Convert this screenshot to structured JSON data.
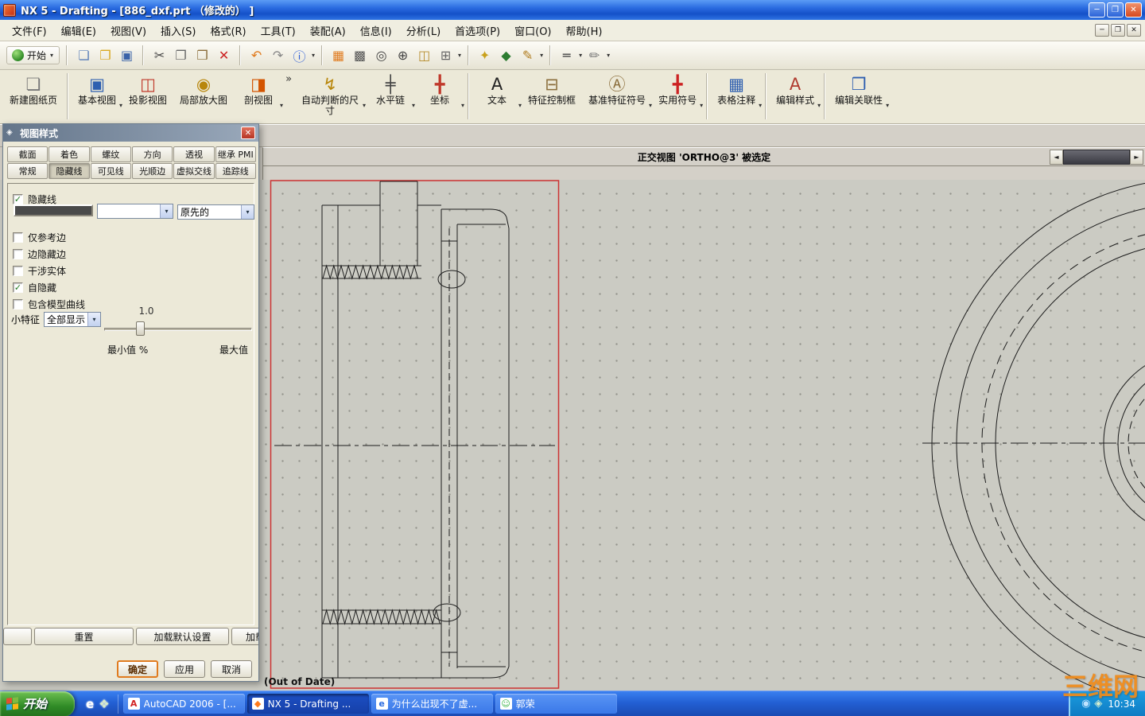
{
  "colors": {
    "selection_red": "#cc3333",
    "watermark_orange": "#f08a18",
    "accent_orange": "#e07b1f",
    "taskbar_blue_light": "#3a80f0",
    "start_green_light": "#6fc152",
    "tray_blue": "#1b9ce0",
    "hidden_line_gray": "#4a4a4a"
  },
  "icons": {
    "minimize": "─",
    "restore": "❐",
    "close": "✕",
    "dropdown": "▾",
    "check": "✓",
    "scroll_left": "◄",
    "scroll_right": "►",
    "overflow": "»",
    "grip": "◈"
  },
  "window": {
    "title": "NX 5 - Drafting - [886_dxf.prt （修改的） ]"
  },
  "menu": {
    "items": [
      "文件(F)",
      "编辑(E)",
      "视图(V)",
      "插入(S)",
      "格式(R)",
      "工具(T)",
      "装配(A)",
      "信息(I)",
      "分析(L)",
      "首选项(P)",
      "窗口(O)",
      "帮助(H)"
    ]
  },
  "toolbar1": {
    "start_label": "开始",
    "icons": [
      {
        "type": "icon",
        "name": "new-file-icon",
        "glyph": "❏",
        "color": "#5b7fb9"
      },
      {
        "type": "icon",
        "name": "open-folder-icon",
        "glyph": "❒",
        "color": "#d9a821"
      },
      {
        "type": "icon",
        "name": "save-icon",
        "glyph": "▣",
        "color": "#3a62a8"
      },
      {
        "type": "sep"
      },
      {
        "type": "icon",
        "name": "cut-icon",
        "glyph": "✂",
        "color": "#444444"
      },
      {
        "type": "icon",
        "name": "copy-icon",
        "glyph": "❐",
        "color": "#666666"
      },
      {
        "type": "icon",
        "name": "paste-icon",
        "glyph": "❒",
        "color": "#8a6d3b"
      },
      {
        "type": "icon",
        "name": "delete-icon",
        "glyph": "✕",
        "color": "#cc2222"
      },
      {
        "type": "sep"
      },
      {
        "type": "icon",
        "name": "undo-icon",
        "glyph": "↶",
        "color": "#e07b1f"
      },
      {
        "type": "icon",
        "name": "redo-icon",
        "glyph": "↷",
        "color": "#888888"
      },
      {
        "type": "icon",
        "name": "command-finder-icon",
        "glyph": "ⓘ",
        "color": "#2a5bd7",
        "dropdown": true
      },
      {
        "type": "sep"
      },
      {
        "type": "icon",
        "name": "ortho-grid-icon",
        "glyph": "▦",
        "color": "#e07b1f"
      },
      {
        "type": "icon",
        "name": "shaded-view-icon",
        "glyph": "▩",
        "color": "#555555"
      },
      {
        "type": "icon",
        "name": "zoom-window-icon",
        "glyph": "◎",
        "color": "#444444"
      },
      {
        "type": "icon",
        "name": "zoom-in-icon",
        "glyph": "⊕",
        "color": "#444444"
      },
      {
        "type": "icon",
        "name": "screenshot-icon",
        "glyph": "◫",
        "color": "#b58a2a"
      },
      {
        "type": "icon",
        "name": "view-operations-icon",
        "glyph": "⊞",
        "color": "#666666",
        "dropdown": true
      },
      {
        "type": "sep"
      },
      {
        "type": "icon",
        "name": "datum-icon",
        "glyph": "✦",
        "color": "#c9a11c"
      },
      {
        "type": "icon",
        "name": "point-icon",
        "glyph": "◆",
        "color": "#2e7d32"
      },
      {
        "type": "icon",
        "name": "sketch-tools-icon",
        "glyph": "✎",
        "color": "#b07c1f",
        "dropdown": true
      },
      {
        "type": "sep"
      },
      {
        "type": "icon",
        "name": "edge-display-icon",
        "glyph": "═",
        "color": "#444444",
        "dropdown": true
      },
      {
        "type": "icon",
        "name": "annotation-pen-icon",
        "glyph": "✏",
        "color": "#777777",
        "dropdown": true
      }
    ]
  },
  "toolbar2": {
    "buttons": [
      {
        "label": "新建图纸页",
        "icon": "new-sheet-icon",
        "glyph": "❏",
        "color": "#777777",
        "dropdown": false
      },
      {
        "type": "sep"
      },
      {
        "label": "基本视图",
        "icon": "base-view-icon",
        "glyph": "▣",
        "color": "#2e5fb0",
        "dropdown": true
      },
      {
        "label": "投影视图",
        "icon": "projected-view-icon",
        "glyph": "◫",
        "color": "#c0392b",
        "dropdown": false
      },
      {
        "label": "局部放大图",
        "icon": "detail-view-icon",
        "glyph": "◉",
        "color": "#b8860b",
        "dropdown": false
      },
      {
        "label": "剖视图",
        "icon": "section-view-icon",
        "glyph": "◨",
        "color": "#d35400",
        "dropdown": true
      },
      {
        "type": "chevron"
      },
      {
        "label": "自动判断的尺寸",
        "icon": "auto-dimension-icon",
        "glyph": "↯",
        "color": "#b8860b",
        "dropdown": true,
        "narrow": true
      },
      {
        "label": "水平链",
        "icon": "horizontal-chain-icon",
        "glyph": "╪",
        "color": "#444444",
        "dropdown": true
      },
      {
        "label": "坐标",
        "icon": "ordinate-icon",
        "glyph": "╋",
        "color": "#c0392b",
        "dropdown": true
      },
      {
        "type": "sep"
      },
      {
        "label": "文本",
        "icon": "text-icon",
        "glyph": "A",
        "color": "#222222",
        "dropdown": true
      },
      {
        "label": "特征控制框",
        "icon": "feature-control-frame-icon",
        "glyph": "⊟",
        "color": "#8a6d3b",
        "dropdown": false
      },
      {
        "label": "基准特征符号",
        "icon": "datum-feature-symbol-icon",
        "glyph": "Ⓐ",
        "color": "#8a6d3b",
        "dropdown": true
      },
      {
        "label": "实用符号",
        "icon": "utility-symbol-icon",
        "glyph": "╋",
        "color": "#cc2222",
        "dropdown": true
      },
      {
        "type": "sep"
      },
      {
        "label": "表格注释",
        "icon": "tabular-note-icon",
        "glyph": "▦",
        "color": "#2e5fb0",
        "dropdown": true
      },
      {
        "type": "sep"
      },
      {
        "label": "编辑样式",
        "icon": "edit-style-icon",
        "glyph": "A",
        "color": "#b03a2e",
        "dropdown": true
      },
      {
        "type": "sep"
      },
      {
        "label": "编辑关联性",
        "icon": "edit-associativity-icon",
        "glyph": "❒",
        "color": "#2e5fb0",
        "dropdown": true
      }
    ]
  },
  "prompt": {
    "text": "正交视图 'ORTHO@3' 被选定"
  },
  "dialog": {
    "title": "视图样式",
    "tabs_row1": [
      "截面",
      "着色",
      "螺纹",
      "方向",
      "透视",
      "继承 PMI"
    ],
    "tabs_row2": [
      "常规",
      "隐藏线",
      "可见线",
      "光顺边",
      "虚拟交线",
      "追踪线"
    ],
    "active_tab": "隐藏线",
    "hidden_line_checkbox": {
      "label": "隐藏线",
      "checked": true
    },
    "linetype_value": "dashed",
    "width_value": "原先的",
    "option_checkboxes": [
      {
        "label": "仅参考边",
        "checked": false
      },
      {
        "label": "边隐藏边",
        "checked": false
      },
      {
        "label": "干涉实体",
        "checked": false
      },
      {
        "label": "自隐藏",
        "checked": true
      },
      {
        "label": "包含模型曲线",
        "checked": false
      }
    ],
    "small_feature_label": "小特征",
    "small_feature_value": "全部显示",
    "slider_value": "1.0",
    "slider_min_label": "最小值 %",
    "slider_max_label": "最大值",
    "buttons": {
      "reset": "重置",
      "load_defaults": "加载默认设置",
      "load": "加载",
      "ok": "确定",
      "apply": "应用",
      "cancel": "取消"
    }
  },
  "canvas": {
    "out_of_date": "(Out of Date)"
  },
  "taskbar": {
    "start_label": "开始",
    "quick_launch": [
      {
        "name": "ie-quicklaunch-icon",
        "glyph": "e",
        "color": "#ffffff"
      },
      {
        "name": "show-desktop-icon",
        "glyph": "❖",
        "color": "#d8ecc8"
      }
    ],
    "tasks": [
      {
        "label": "AutoCAD 2006 - [...",
        "icon": "autocad-icon",
        "glyph": "A",
        "color": "#d22222",
        "active": false
      },
      {
        "label": "NX 5 - Drafting ...",
        "icon": "nx-icon",
        "glyph": "◆",
        "color": "#ff7a1a",
        "active": true
      },
      {
        "label": "为什么出现不了虚...",
        "icon": "ie-icon",
        "glyph": "e",
        "color": "#2a6be0",
        "active": false
      },
      {
        "label": "郭荣",
        "icon": "messenger-icon",
        "glyph": "☺",
        "color": "#3ab54a",
        "active": false
      }
    ],
    "tray_icons": [
      {
        "name": "tray-network-icon",
        "glyph": "◉",
        "color": "#bfe3ff"
      },
      {
        "name": "tray-volume-icon",
        "glyph": "◈",
        "color": "#d7f0d0"
      }
    ],
    "time": "10:34",
    "watermark": "三维网"
  }
}
